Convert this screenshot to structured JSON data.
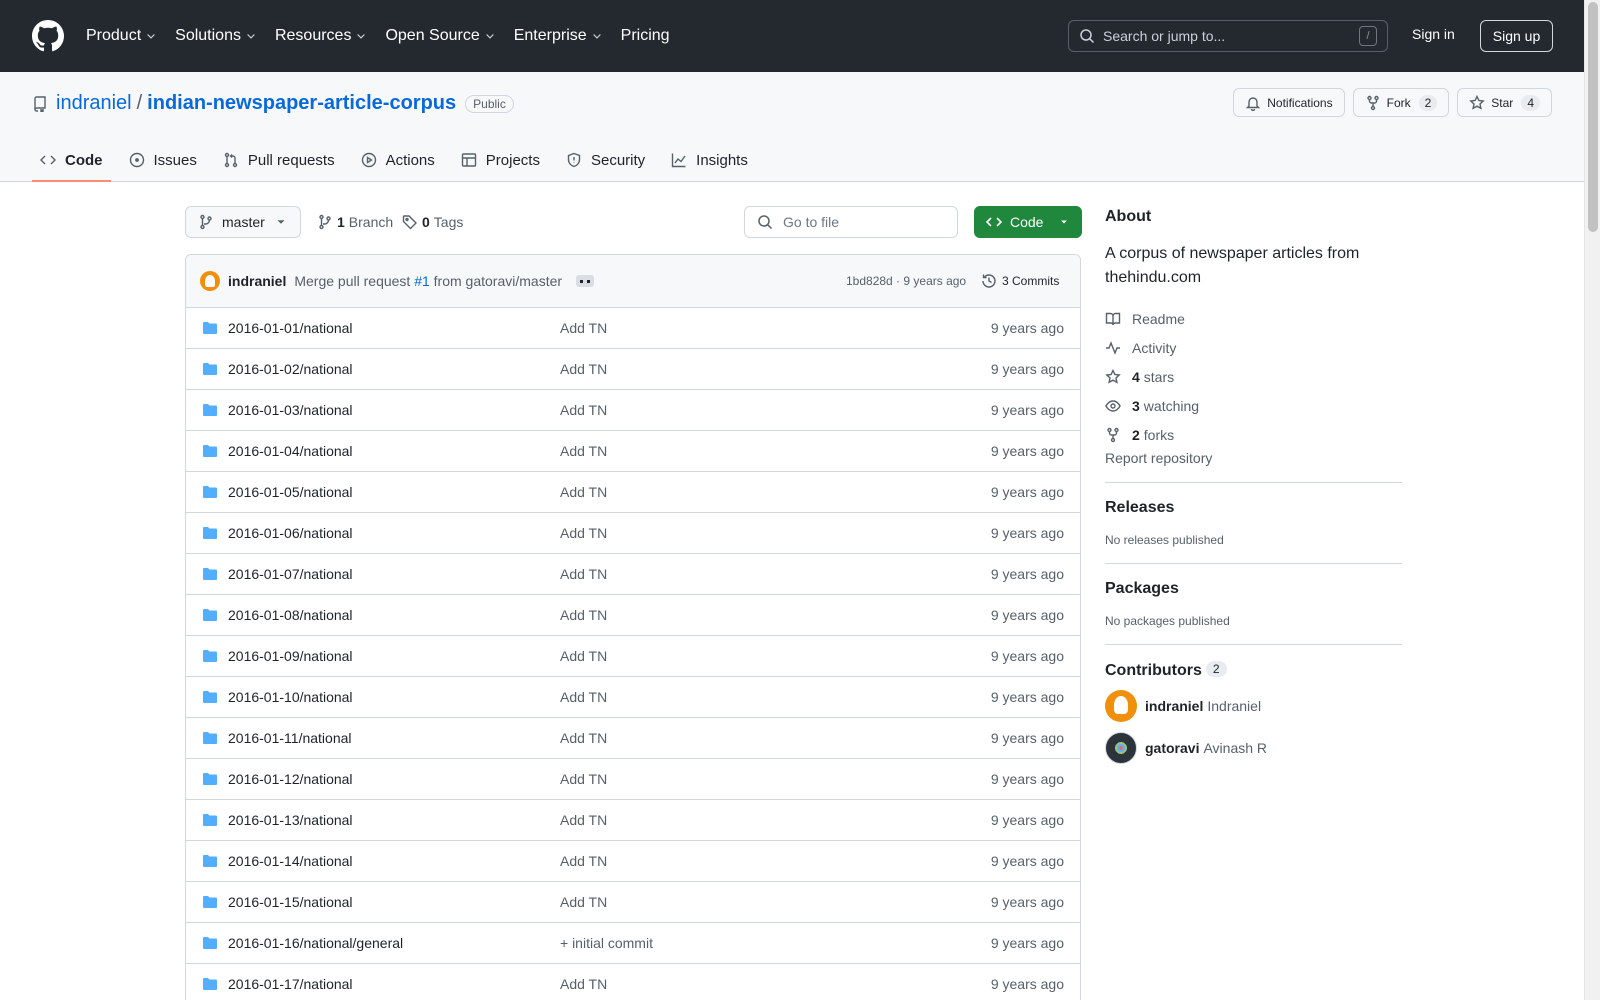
{
  "header": {
    "nav": [
      {
        "label": "Product",
        "dropdown": true
      },
      {
        "label": "Solutions",
        "dropdown": true
      },
      {
        "label": "Resources",
        "dropdown": true
      },
      {
        "label": "Open Source",
        "dropdown": true
      },
      {
        "label": "Enterprise",
        "dropdown": true
      },
      {
        "label": "Pricing",
        "dropdown": false
      }
    ],
    "search_placeholder": "Search or jump to...",
    "search_shortcut": "/",
    "signin": "Sign in",
    "signup": "Sign up"
  },
  "repo": {
    "owner": "indraniel",
    "separator": "/",
    "name": "indian-newspaper-article-corpus",
    "visibility": "Public",
    "notifications_label": "Notifications",
    "fork_label": "Fork",
    "fork_count": "2",
    "star_label": "Star",
    "star_count": "4"
  },
  "tabs": [
    {
      "label": "Code",
      "icon": "code-icon",
      "active": true
    },
    {
      "label": "Issues",
      "icon": "issue-icon",
      "active": false
    },
    {
      "label": "Pull requests",
      "icon": "pull-request-icon",
      "active": false
    },
    {
      "label": "Actions",
      "icon": "play-icon",
      "active": false
    },
    {
      "label": "Projects",
      "icon": "table-icon",
      "active": false
    },
    {
      "label": "Security",
      "icon": "shield-icon",
      "active": false
    },
    {
      "label": "Insights",
      "icon": "graph-icon",
      "active": false
    }
  ],
  "toolbar": {
    "branch": "master",
    "branch_count": "1",
    "branch_label": "Branch",
    "tag_count": "0",
    "tag_label": "Tags",
    "goto_placeholder": "Go to file",
    "code_button": "Code"
  },
  "commit": {
    "author": "indraniel",
    "message_prefix": "Merge pull request",
    "pr": "#1",
    "message_suffix": "from gatoravi/master",
    "hash_age": "1bd828d · 9 years ago",
    "commits_label": "3 Commits"
  },
  "files": [
    {
      "name": "2016-01-01/national",
      "msg": "Add TN",
      "age": "9 years ago"
    },
    {
      "name": "2016-01-02/national",
      "msg": "Add TN",
      "age": "9 years ago"
    },
    {
      "name": "2016-01-03/national",
      "msg": "Add TN",
      "age": "9 years ago"
    },
    {
      "name": "2016-01-04/national",
      "msg": "Add TN",
      "age": "9 years ago"
    },
    {
      "name": "2016-01-05/national",
      "msg": "Add TN",
      "age": "9 years ago"
    },
    {
      "name": "2016-01-06/national",
      "msg": "Add TN",
      "age": "9 years ago"
    },
    {
      "name": "2016-01-07/national",
      "msg": "Add TN",
      "age": "9 years ago"
    },
    {
      "name": "2016-01-08/national",
      "msg": "Add TN",
      "age": "9 years ago"
    },
    {
      "name": "2016-01-09/national",
      "msg": "Add TN",
      "age": "9 years ago"
    },
    {
      "name": "2016-01-10/national",
      "msg": "Add TN",
      "age": "9 years ago"
    },
    {
      "name": "2016-01-11/national",
      "msg": "Add TN",
      "age": "9 years ago"
    },
    {
      "name": "2016-01-12/national",
      "msg": "Add TN",
      "age": "9 years ago"
    },
    {
      "name": "2016-01-13/national",
      "msg": "Add TN",
      "age": "9 years ago"
    },
    {
      "name": "2016-01-14/national",
      "msg": "Add TN",
      "age": "9 years ago"
    },
    {
      "name": "2016-01-15/national",
      "msg": "Add TN",
      "age": "9 years ago"
    },
    {
      "name": "2016-01-16/national/general",
      "msg": "+ initial commit",
      "age": "9 years ago"
    },
    {
      "name": "2016-01-17/national",
      "msg": "Add TN",
      "age": "9 years ago"
    }
  ],
  "about": {
    "heading": "About",
    "description": "A corpus of newspaper articles from thehindu.com",
    "readme": "Readme",
    "activity": "Activity",
    "stars_count": "4",
    "stars_label": "stars",
    "watching_count": "3",
    "watching_label": "watching",
    "forks_count": "2",
    "forks_label": "forks",
    "report": "Report repository"
  },
  "releases": {
    "heading": "Releases",
    "empty": "No releases published"
  },
  "packages": {
    "heading": "Packages",
    "empty": "No packages published"
  },
  "contributors": {
    "heading": "Contributors",
    "count": "2",
    "items": [
      {
        "login": "indraniel",
        "name": "Indraniel",
        "avatar": "orange"
      },
      {
        "login": "gatoravi",
        "name": "Avinash R",
        "avatar": "dark"
      }
    ]
  }
}
